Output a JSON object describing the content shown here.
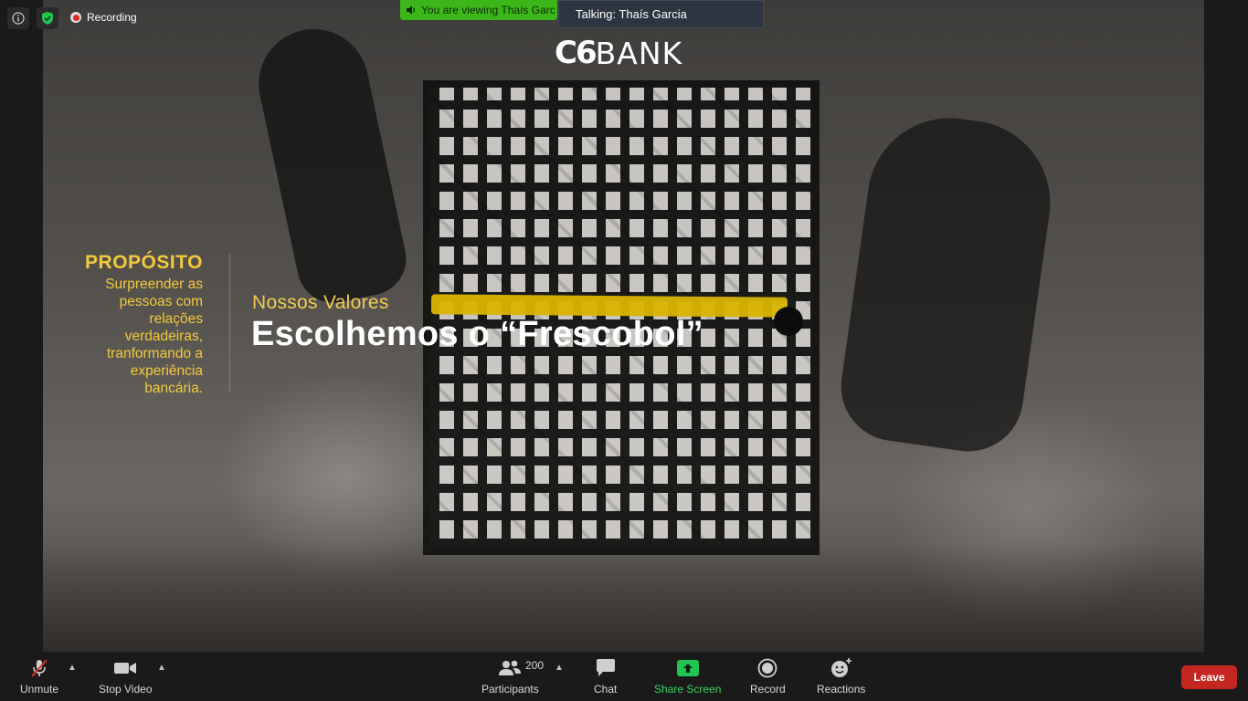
{
  "header": {
    "recording_label": "Recording",
    "viewing_label": "You are viewing Thaís Garc",
    "talking_label": "Talking: Thaís Garcia"
  },
  "slide": {
    "brand_c6": "C6",
    "brand_bank": "BANK",
    "purpose_title": "PROPÓSITO",
    "purpose_lines": [
      "Surpreender as",
      "pessoas com",
      "relações",
      "verdadeiras,",
      "tranformando a",
      "experiência",
      "bancária."
    ],
    "subtitle": "Nossos Valores",
    "title": "Escolhemos o “Frescobol”"
  },
  "toolbar": {
    "unmute_label": "Unmute",
    "stop_video_label": "Stop Video",
    "participants_label": "Participants",
    "participants_count": "200",
    "chat_label": "Chat",
    "share_screen_label": "Share Screen",
    "record_label": "Record",
    "reactions_label": "Reactions",
    "leave_label": "Leave"
  },
  "colors": {
    "accent_yellow": "#f3c93c",
    "share_green": "#3cd35f",
    "leave_red": "#c3271f",
    "banner_green": "#3cb71a"
  }
}
